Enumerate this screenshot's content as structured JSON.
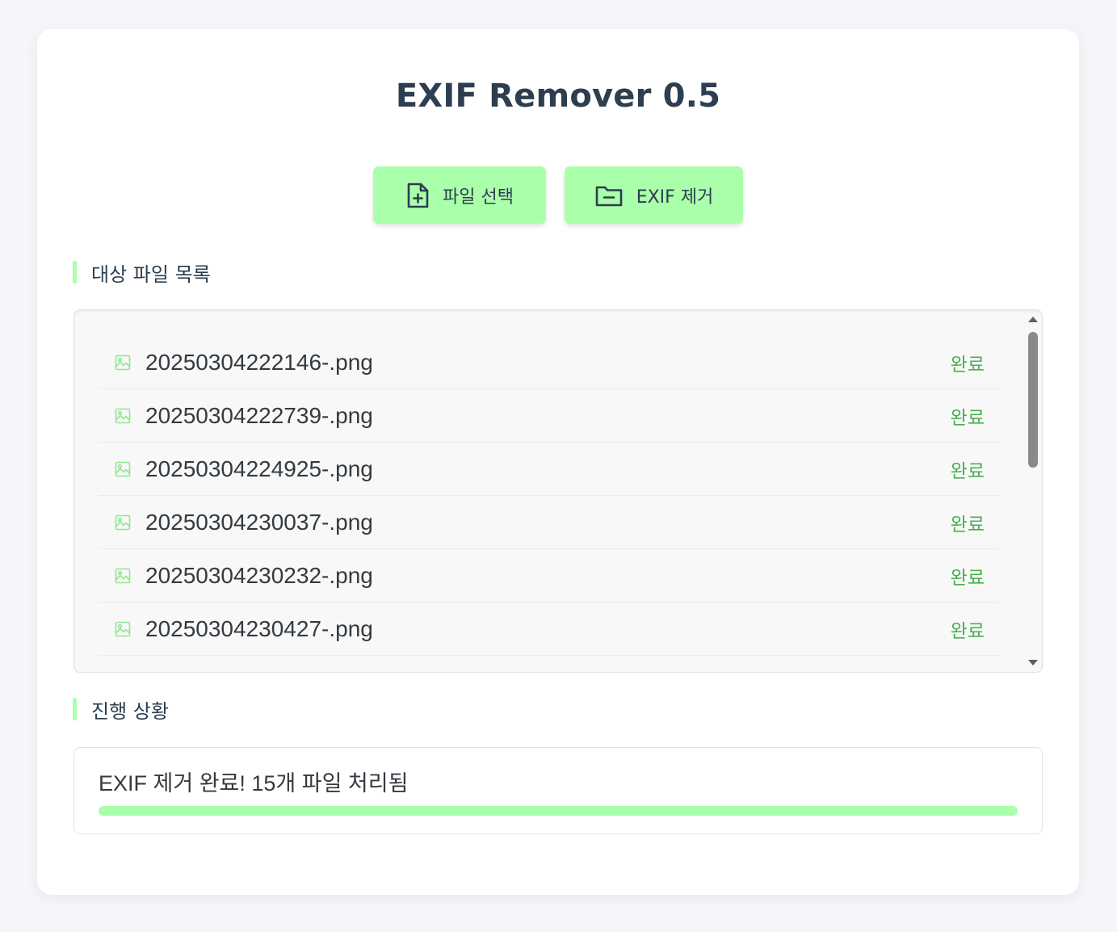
{
  "app": {
    "title": "EXIF Remover 0.5"
  },
  "toolbar": {
    "select_label": "파일 선택",
    "remove_label": "EXIF 제거"
  },
  "file_section": {
    "label": "대상 파일 목록",
    "files": [
      {
        "name": "20250304222146-.png",
        "status": "완료"
      },
      {
        "name": "20250304222739-.png",
        "status": "완료"
      },
      {
        "name": "20250304224925-.png",
        "status": "완료"
      },
      {
        "name": "20250304230037-.png",
        "status": "완료"
      },
      {
        "name": "20250304230232-.png",
        "status": "완료"
      },
      {
        "name": "20250304230427-.png",
        "status": "완료"
      }
    ]
  },
  "progress_section": {
    "label": "진행 상황",
    "message": "EXIF 제거 완료! 15개 파일 처리됨",
    "progress_fraction": 1.0
  },
  "colors": {
    "accent": "#aaffaa",
    "status_done": "#4caf50",
    "title_text": "#2c3e50"
  }
}
